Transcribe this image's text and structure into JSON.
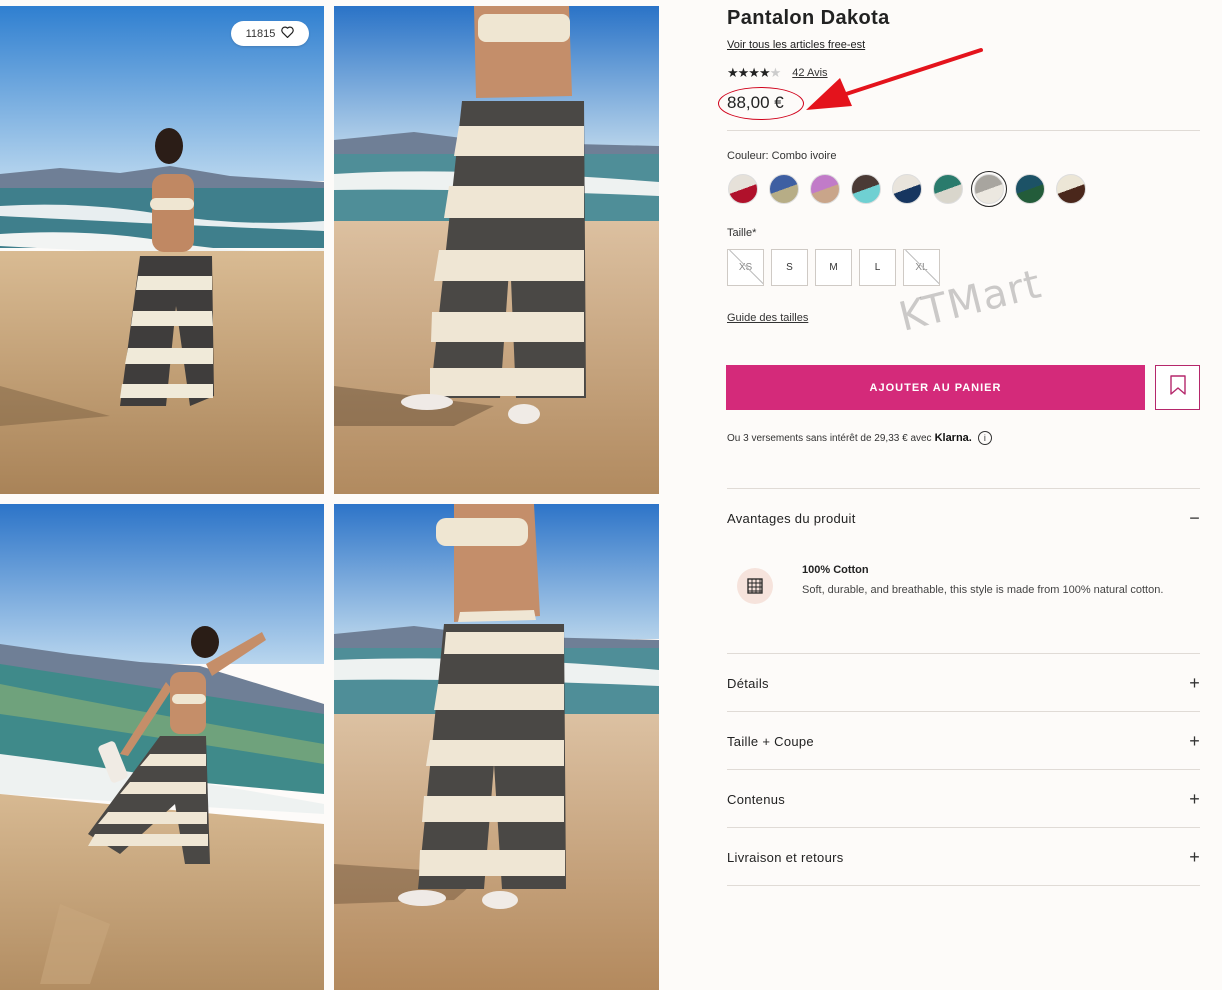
{
  "gallery": {
    "wishlist_count": "11815",
    "icons": {
      "wishlist": "heart-icon"
    }
  },
  "product": {
    "title": "Pantalon Dakota",
    "brand_link": "Voir tous les articles free-est",
    "rating_stars": "★★★★",
    "rating_empty": "★",
    "rating_value": 4,
    "reviews": "42 Avis",
    "price": "88,00 €"
  },
  "colors": {
    "label": "Couleur: Combo ivoire",
    "selected_index": 6,
    "swatches": [
      {
        "top": "#e6e1d9",
        "bottom": "#b0112b"
      },
      {
        "top": "#3e5fa2",
        "bottom": "#b7ad86"
      },
      {
        "top": "#c17bc8",
        "bottom": "#c9a58a"
      },
      {
        "top": "#4a3a35",
        "bottom": "#6fd0d2"
      },
      {
        "top": "#e9e4dc",
        "bottom": "#173660"
      },
      {
        "top": "#2a7b6c",
        "bottom": "#d9d6cc"
      },
      {
        "top": "#a8a59f",
        "bottom": "#ece8e0"
      },
      {
        "top": "#1c5266",
        "bottom": "#235c3a"
      },
      {
        "top": "#ece6d6",
        "bottom": "#4a271b"
      }
    ]
  },
  "sizes": {
    "label": "Taille*",
    "options": [
      {
        "label": "XS",
        "available": false
      },
      {
        "label": "S",
        "available": true
      },
      {
        "label": "M",
        "available": true
      },
      {
        "label": "L",
        "available": true
      },
      {
        "label": "XL",
        "available": false
      }
    ],
    "guide": "Guide des tailles"
  },
  "watermark": "KTMart",
  "cart": {
    "add_label": "AJOUTER AU PANIER",
    "save_icon": "bookmark-icon",
    "accent": "#d42a7a"
  },
  "klarna": {
    "text": "Ou 3 versements sans intérêt de 29,33 € avec",
    "brand": "Klarna.",
    "info_icon": "i"
  },
  "accordion": {
    "benefits": {
      "label": "Avantages du produit",
      "sign": "−"
    },
    "benefit_title": "100% Cotton",
    "benefit_text": "Soft, durable, and breathable, this style is made from 100% natural cotton.",
    "details": {
      "label": "Détails",
      "sign": "+"
    },
    "fit": {
      "label": "Taille + Coupe",
      "sign": "+"
    },
    "contents": {
      "label": "Contenus",
      "sign": "+"
    },
    "shipping": {
      "label": "Livraison et retours",
      "sign": "+"
    }
  },
  "annotation": {
    "color": "#e4131c"
  }
}
